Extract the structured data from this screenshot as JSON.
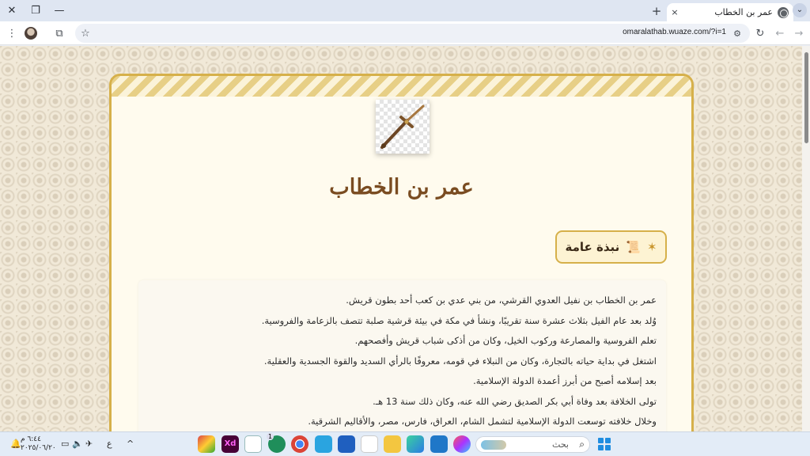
{
  "browser": {
    "tab_title": "عمر بن الخطاب",
    "tab_close": "×",
    "new_tab": "+",
    "url": "omaralathab.wuaze.com/?i=1",
    "window_controls": {
      "close": "✕",
      "restore": "❐",
      "minimize": "—"
    },
    "toolbar_icons": [
      "menu-icon",
      "extensions-icon",
      "star-icon",
      "site-settings-icon",
      "reload-icon",
      "back-icon",
      "forward-icon"
    ]
  },
  "page": {
    "title": "عمر بن الخطاب",
    "section_heading": "نبذة عامة",
    "paragraphs": [
      "عمر بن الخطاب بن نفيل العدوي القرشي، من بني عدي بن كعب أحد بطون قريش.",
      "وُلد بعد عام الفيل بثلاث عشرة سنة تقريبًا، ونشأ في مكة في بيئة قرشية صلبة تتصف بالزعامة والفروسية.",
      "تعلم الفروسية والمصارعة وركوب الخيل، وكان من أذكى شباب قريش وأفصحهم.",
      "اشتغل في بداية حياته بالتجارة، وكان من النبلاء في قومه، معروفًا بالرأي السديد والقوة الجسدية والعقلية.",
      "بعد إسلامه أصبح من أبرز أعمدة الدولة الإسلامية.",
      "تولى الخلافة بعد وفاة أبي بكر الصديق رضي الله عنه، وكان ذلك سنة 13 هـ.",
      "وخلال خلافته توسعت الدولة الإسلامية لتشمل الشام، العراق، فارس، مصر، والأقاليم الشرقية."
    ]
  },
  "taskbar": {
    "time": "٦:٤٤ م",
    "date": "٢٠٢٥/٠٦/٢٠",
    "lang": "ع",
    "search_placeholder": "بحث",
    "chevron": "^",
    "app_badge": "1",
    "xd_label": "Xd"
  }
}
